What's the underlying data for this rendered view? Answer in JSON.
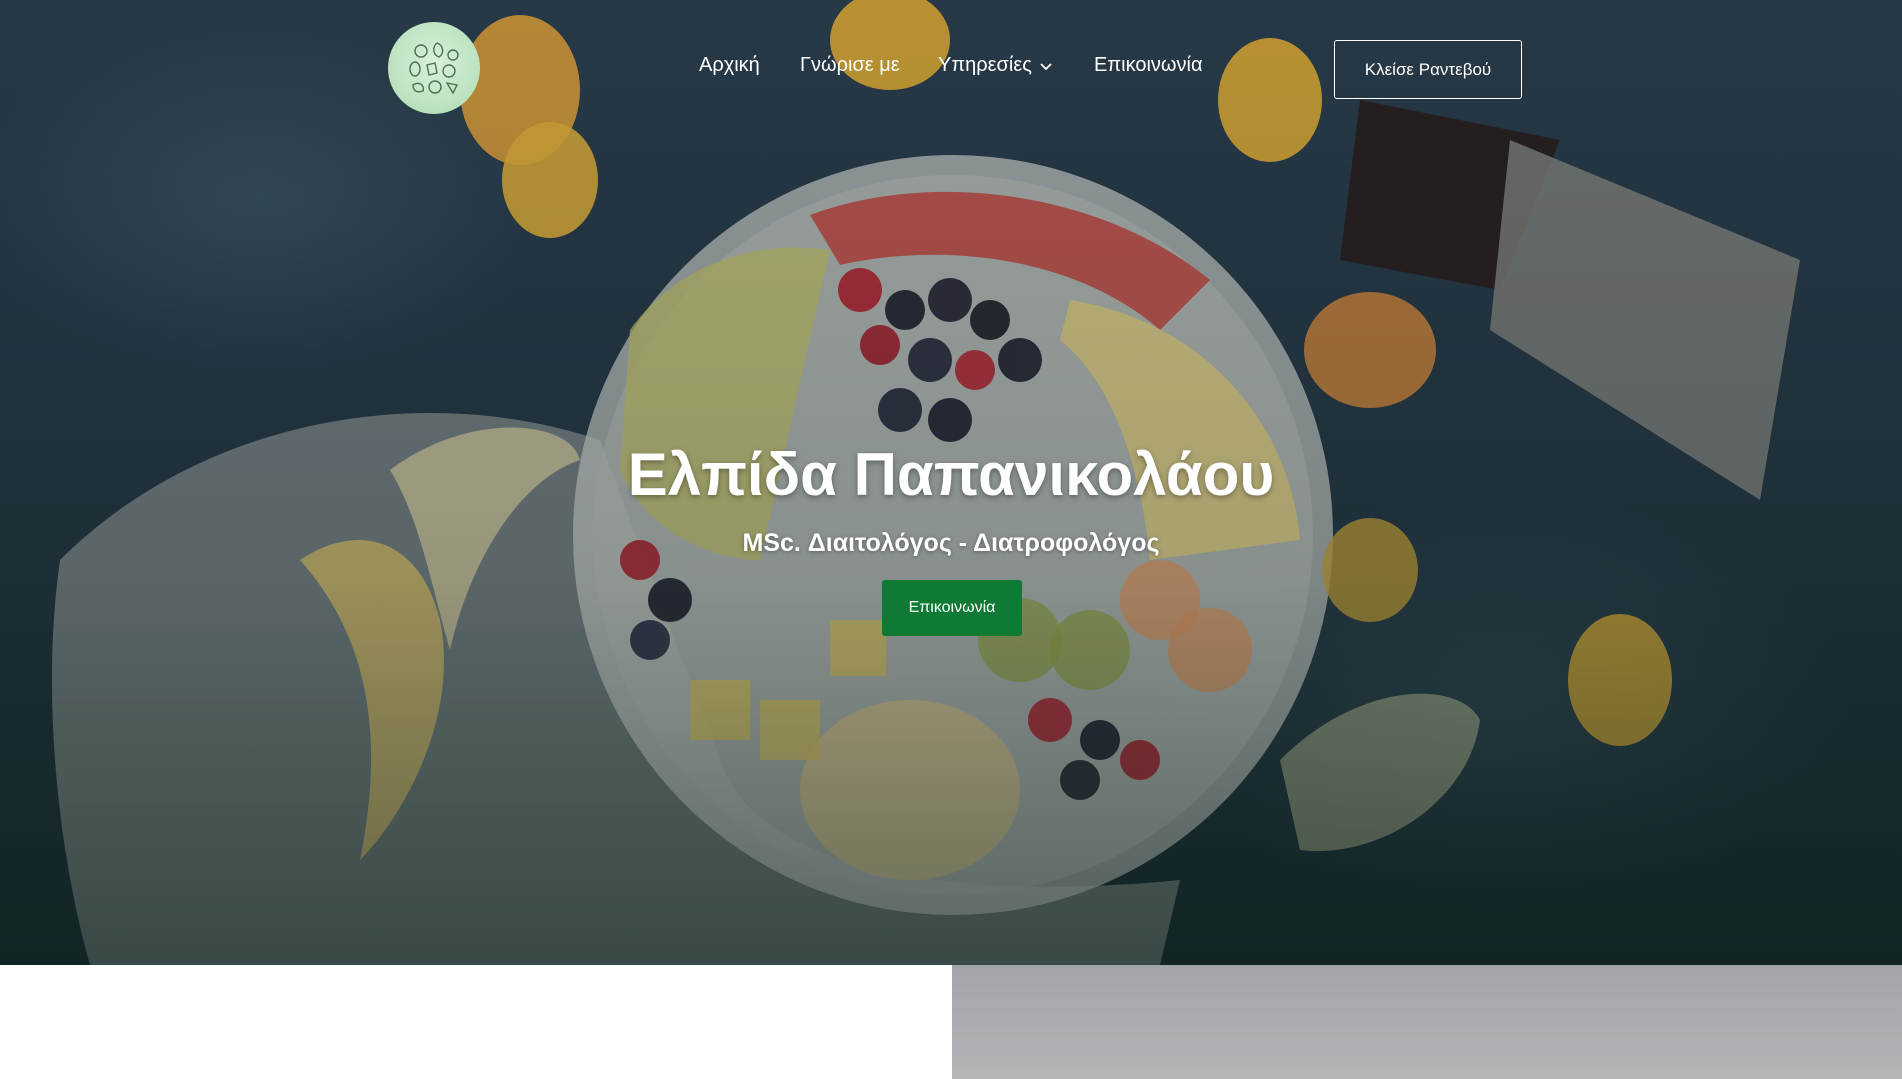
{
  "nav": {
    "items": [
      {
        "label": "Αρχική"
      },
      {
        "label": "Γνώρισε με"
      },
      {
        "label": "Υπηρεσίες"
      },
      {
        "label": "Επικοινωνία"
      }
    ],
    "cta_label": "Κλείσε Ραντεβού"
  },
  "hero": {
    "title": "Ελπίδα Παπανικολάου",
    "subtitle": "MSc. Διαιτολόγος - Διατροφολόγος",
    "button_label": "Επικοινωνία"
  },
  "colors": {
    "accent_green": "#0f7a34",
    "logo_bg": "#bfe4c3",
    "hero_bg": "#263846"
  },
  "icons": [
    "fruit-logo-icon",
    "chevron-down-icon"
  ]
}
